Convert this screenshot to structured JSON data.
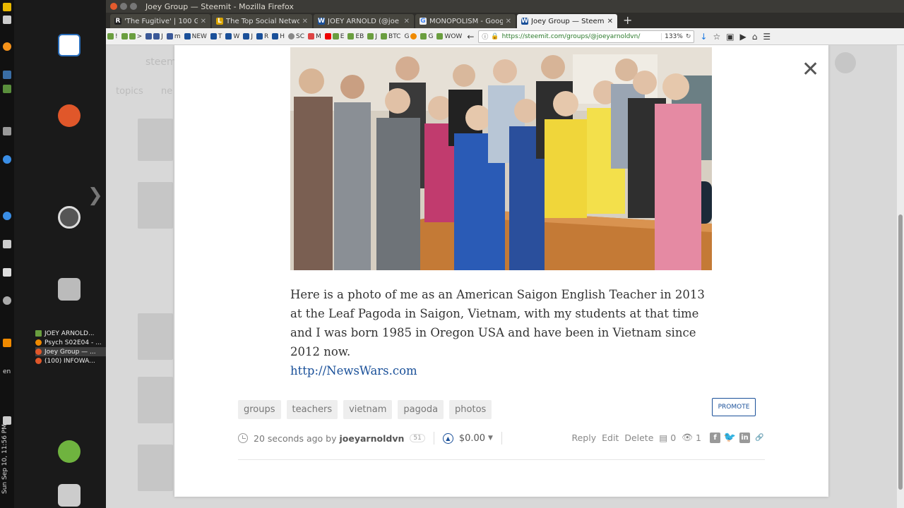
{
  "window": {
    "title": "Joey Group — Steemit - Mozilla Firefox"
  },
  "tabs": [
    {
      "title": "'The Fugitive' | 100 Gr",
      "favicon": "R",
      "color": "#222222"
    },
    {
      "title": "The Top Social Networ",
      "favicon": "L",
      "color": "#d9a400"
    },
    {
      "title": "JOEY ARNOLD (@joe",
      "favicon": "W",
      "color": "#1a5099"
    },
    {
      "title": "MONOPOLISM - Goog",
      "favicon": "G",
      "color": "#e2e2e2"
    },
    {
      "title": "Joey Group — Steemit",
      "favicon": "W",
      "color": "#1a5099",
      "active": true
    }
  ],
  "bookmarks": [
    "!",
    ">",
    "J",
    "m",
    "NEW",
    "T",
    "W",
    "J",
    "R",
    "H",
    "SC",
    "M",
    "E",
    "EB",
    "J",
    "BTC",
    "G",
    "G",
    "WOW"
  ],
  "url": "https://steemit.com/groups/@joeyarnoldvn/",
  "zoom": "133%",
  "taskbar": [
    {
      "label": "JOEY ARNOLD...",
      "color": "#6a9e3f"
    },
    {
      "label": "Psych S02E04 - ...",
      "color": "#f08a00"
    },
    {
      "label": "Joey Group — ...",
      "color": "#e0572a"
    },
    {
      "label": "(100) INFOWA...",
      "color": "#e0572a"
    }
  ],
  "clock": "Sun Sep 10, 11:56 PM",
  "lang": "en",
  "post": {
    "body": "Here is a photo of me as an American Saigon English Teacher in 2013 at the Leaf Pagoda in Saigon, Vietnam, with my students at that time and I was born 1985 in Oregon USA and have been in Vietnam since 2012 now.",
    "link": "http://NewsWars.com",
    "tags": [
      "groups",
      "teachers",
      "vietnam",
      "pagoda",
      "photos"
    ],
    "promote": "PROMOTE",
    "time": "20 seconds ago by",
    "author": "joeyarnoldvn",
    "reputation": "51",
    "payout": "$0.00",
    "actions": [
      "Reply",
      "Edit",
      "Delete"
    ],
    "comments": "0",
    "views": "1"
  },
  "background": {
    "logo": "steem",
    "nav": [
      "topics",
      "ne"
    ]
  }
}
